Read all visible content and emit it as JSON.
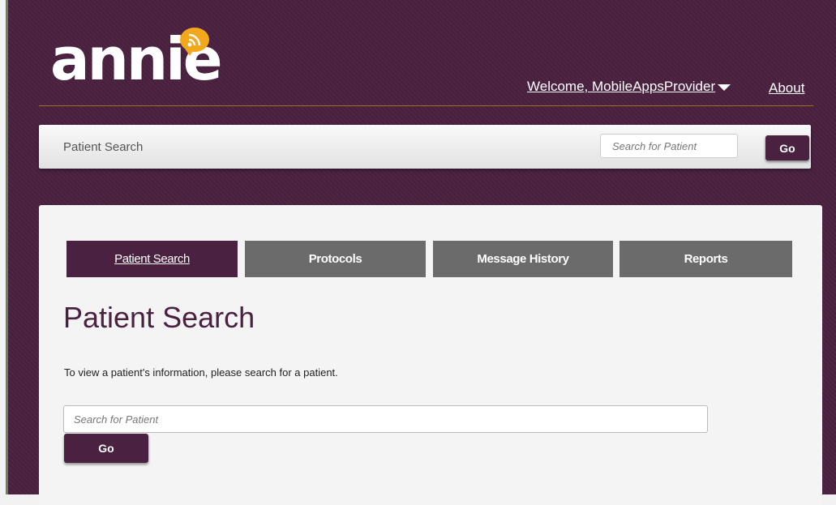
{
  "brand": {
    "logo_text": "annie",
    "logo_color": "#ffffff",
    "accent": "#f2a81d"
  },
  "colors": {
    "background": "#4a2140",
    "tab_active": "#4a2140",
    "tab_inactive": "#6b6b6b",
    "divider": "#a0701e"
  },
  "header": {
    "welcome_label": "Welcome, MobileAppsProvider",
    "about_label": "About"
  },
  "topbar": {
    "title": "Patient Search",
    "search_placeholder": "Search for Patient",
    "go_label": "Go"
  },
  "tabs": [
    {
      "label": "Patient Search",
      "active": true
    },
    {
      "label": "Protocols",
      "active": false
    },
    {
      "label": "Message History",
      "active": false
    },
    {
      "label": "Reports",
      "active": false
    }
  ],
  "main": {
    "title": "Patient Search",
    "instructions": "To view a patient's information, please search for a patient.",
    "search_placeholder": "Search for Patient",
    "go_label": "Go"
  },
  "icons": {
    "logo_bubble": "rss-feed-icon",
    "welcome_caret": "caret-down-icon"
  }
}
